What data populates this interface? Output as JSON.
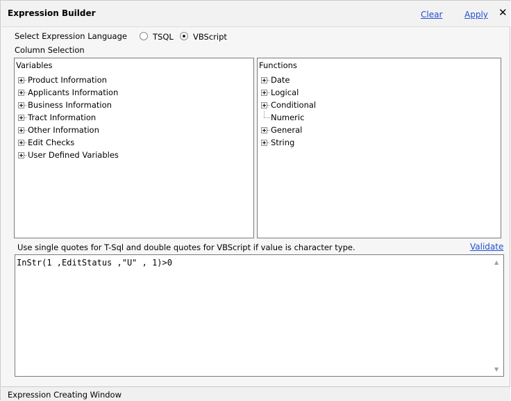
{
  "window": {
    "title": "Expression Builder",
    "clear_label": "Clear",
    "apply_label": "Apply",
    "close_glyph": "✕"
  },
  "language": {
    "label": "Select Expression Language",
    "options": [
      {
        "label": "TSQL",
        "checked": false
      },
      {
        "label": "VBScript",
        "checked": true
      }
    ]
  },
  "column_selection_label": "Column Selection",
  "variables": {
    "header": "Variables",
    "items": [
      "Product Information",
      "Applicants Information",
      "Business Information",
      "Tract Information",
      "Other Information",
      "Edit Checks",
      "User Defined Variables"
    ]
  },
  "functions": {
    "header": "Functions",
    "items": [
      {
        "label": "Date",
        "expandable": true
      },
      {
        "label": "Logical",
        "expandable": true
      },
      {
        "label": "Conditional",
        "expandable": true
      },
      {
        "label": "Numeric",
        "expandable": false
      },
      {
        "label": "General",
        "expandable": true
      },
      {
        "label": "String",
        "expandable": true
      }
    ]
  },
  "hint": "Use single quotes for T-Sql and double quotes for VBScript if value is character type.",
  "validate_label": "Validate",
  "expression": "InStr(1 ,EditStatus ,\"U\" , 1)>0",
  "scroll": {
    "up_glyph": "▲",
    "down_glyph": "▼"
  },
  "status": "Expression Creating Window",
  "colors": {
    "link": "#1f4fcf",
    "frame": "#f6f6f6"
  }
}
